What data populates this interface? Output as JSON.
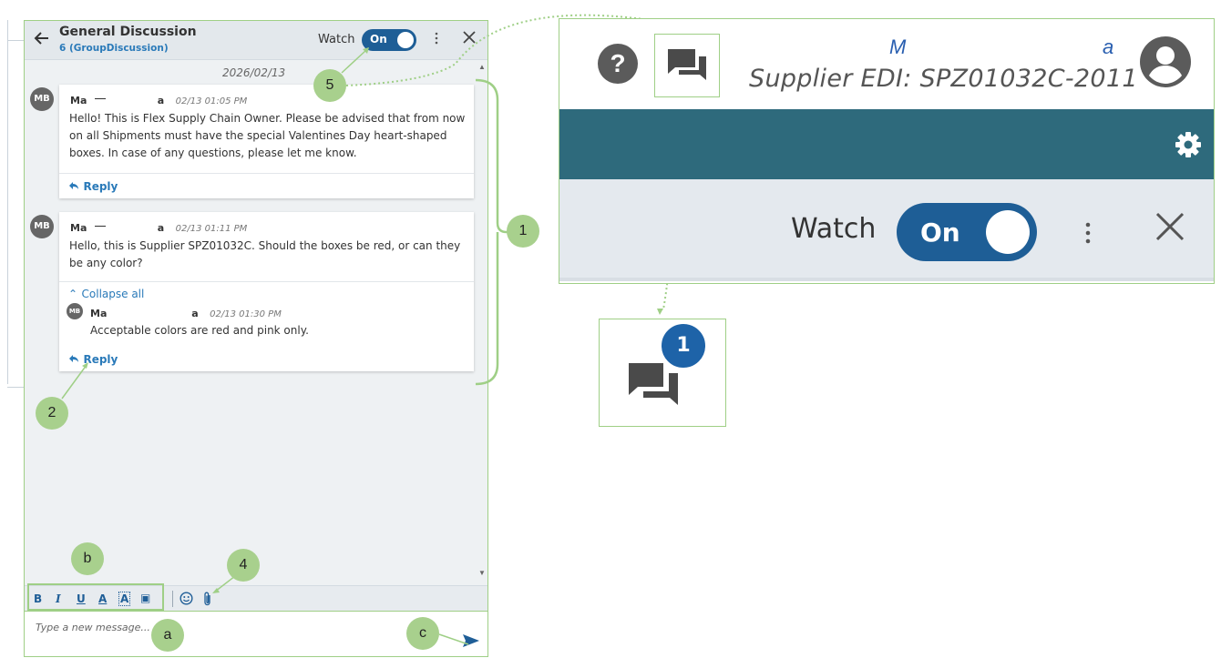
{
  "chat": {
    "title": "General Discussion",
    "subtitle": "6 (GroupDiscussion)",
    "watch_label": "Watch",
    "watch_state": "On",
    "date": "2026/02/13",
    "messages": [
      {
        "avatar": "MB",
        "author": "Ma",
        "author_end": "a",
        "time": "02/13 01:05 PM",
        "text": "Hello! This is Flex Supply Chain Owner. Please be advised that from now on all Shipments must have the special Valentines Day heart-shaped boxes. In case of any questions, please let me know.",
        "reply_label": "Reply"
      },
      {
        "avatar": "MB",
        "author": "Ma",
        "author_end": "a",
        "time": "02/13 01:11 PM",
        "text": "Hello, this is Supplier SPZ01032C. Should the boxes be red, or can they be any color?",
        "collapse_label": "Collapse all",
        "reply": {
          "avatar": "MB",
          "author": "Ma",
          "author_end": "a",
          "time": "02/13 01:30 PM",
          "text": "Acceptable colors are red and pink only."
        },
        "reply_label": "Reply"
      }
    ],
    "toolbar": [
      "B",
      "I",
      "U",
      "A",
      "A",
      "▣"
    ],
    "composer_placeholder": "Type a new message..."
  },
  "callouts": {
    "one": "1",
    "two": "2",
    "four": "4",
    "five": "5",
    "a": "a",
    "b": "b",
    "c": "c"
  },
  "zoom": {
    "help": "?",
    "org_start": "M",
    "org_end": "a",
    "supplier": "Supplier EDI: SPZ01032C-2011",
    "watch_label": "Watch",
    "watch_state": "On"
  },
  "badge": {
    "count": "1"
  },
  "colors": {
    "accent": "#1e5e96",
    "callout": "#a8d08d",
    "band": "#2e6a7c",
    "link": "#2a7ab9"
  }
}
